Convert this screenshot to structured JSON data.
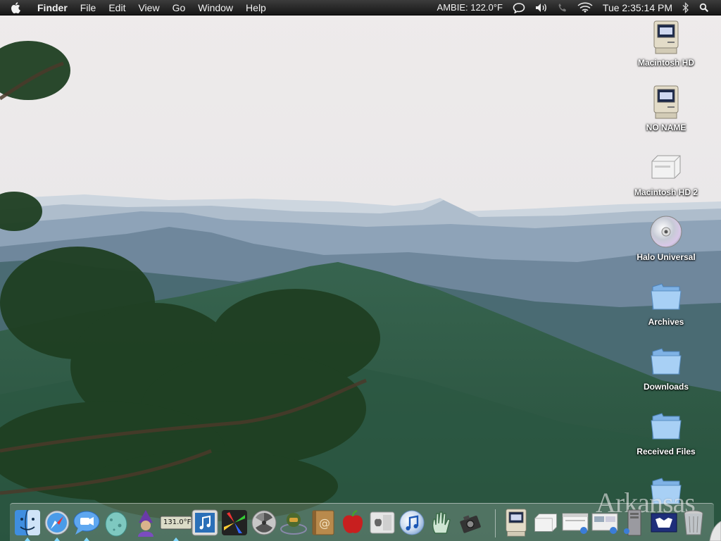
{
  "menubar": {
    "apple_icon": "apple-icon",
    "app_name": "Finder",
    "menus": [
      "File",
      "Edit",
      "View",
      "Go",
      "Window",
      "Help"
    ],
    "status": {
      "temperature": "AMBIE: 122.0°F",
      "clock": "Tue 2:35:14 PM"
    }
  },
  "desktop": {
    "icons": [
      {
        "label": "Macintosh HD",
        "icon": "classic-mac-icon"
      },
      {
        "label": "NO NAME",
        "icon": "classic-mac-icon"
      },
      {
        "label": "Macintosh HD 2",
        "icon": "external-drive-icon"
      },
      {
        "label": "Halo Universal",
        "icon": "cd-disc-icon"
      },
      {
        "label": "Archives",
        "icon": "folder-icon"
      },
      {
        "label": "Downloads",
        "icon": "folder-icon"
      },
      {
        "label": "Received Files",
        "icon": "folder-icon"
      },
      {
        "label": "",
        "icon": "folder-icon"
      }
    ]
  },
  "dock": {
    "thermometer_readout": "131.0°F",
    "items": [
      "finder-icon",
      "safari-icon",
      "ichat-icon",
      "egg-icon",
      "wizard-icon",
      "thermometer-icon",
      "itunes-mini-icon",
      "pinwheel-icon",
      "radiation-icon",
      "halo-icon",
      "address-book-icon",
      "apple-red-icon",
      "system-prefs-icon",
      "itunes-icon",
      "hand-icon",
      "camera-icon",
      "classic-mac-icon",
      "drive-icon",
      "window-icon",
      "screens-icon",
      "tower-icon",
      "logo-icon",
      "trash-icon"
    ]
  },
  "watermark": "Arkansas",
  "colors": {
    "menubar": "#1c1c1c",
    "sky": "#f1eeee",
    "forest": "#2e5d45",
    "haze": "#8aa2b7"
  }
}
